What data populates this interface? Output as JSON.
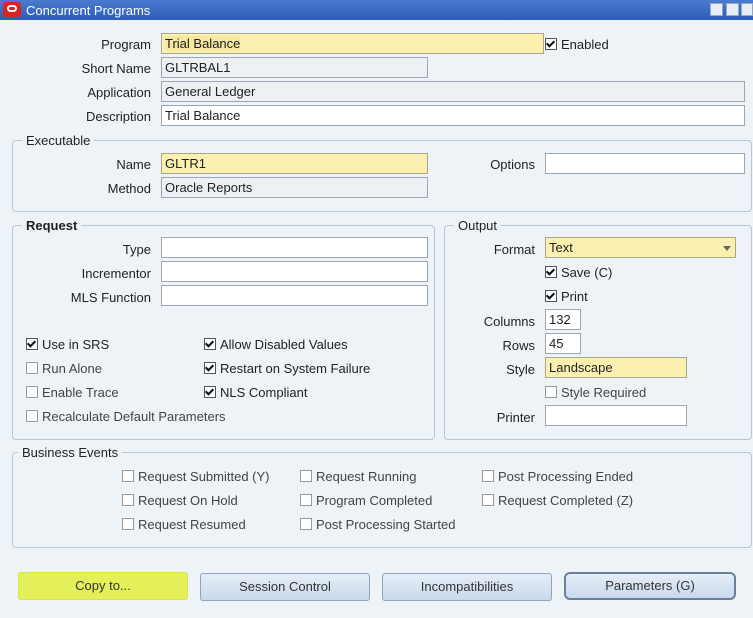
{
  "window": {
    "title": "Concurrent Programs"
  },
  "program": {
    "program_label": "Program",
    "program_value": "Trial Balance",
    "enabled_label": "Enabled",
    "enabled": true,
    "short_name_label": "Short Name",
    "short_name_value": "GLTRBAL1",
    "application_label": "Application",
    "application_value": "General Ledger",
    "description_label": "Description",
    "description_value": "Trial Balance"
  },
  "executable": {
    "title": "Executable",
    "name_label": "Name",
    "name_value": "GLTR1",
    "method_label": "Method",
    "method_value": "Oracle Reports",
    "options_label": "Options",
    "options_value": ""
  },
  "request": {
    "title": "Request",
    "type_label": "Type",
    "type_value": "",
    "incrementor_label": "Incrementor",
    "incrementor_value": "",
    "mls_label": "MLS Function",
    "mls_value": "",
    "checks": {
      "use_in_srs": "Use in SRS",
      "run_alone": "Run Alone",
      "enable_trace": "Enable Trace",
      "recalc": "Recalculate Default Parameters",
      "allow_disabled": "Allow Disabled Values",
      "restart": "Restart on System Failure",
      "nls": "NLS Compliant"
    }
  },
  "output": {
    "title": "Output",
    "format_label": "Format",
    "format_value": "Text",
    "save_label": "Save (C)",
    "print_label": "Print",
    "columns_label": "Columns",
    "columns_value": "132",
    "rows_label": "Rows",
    "rows_value": "45",
    "style_label": "Style",
    "style_value": "Landscape",
    "style_required_label": "Style Required",
    "printer_label": "Printer",
    "printer_value": ""
  },
  "business_events": {
    "title": "Business Events",
    "submitted": "Request Submitted (Y)",
    "on_hold": "Request On Hold",
    "resumed": "Request Resumed",
    "running": "Request Running",
    "completed_prog": "Program Completed",
    "pp_started": "Post Processing Started",
    "pp_ended": "Post Processing Ended",
    "req_completed": "Request Completed (Z)"
  },
  "buttons": {
    "copy": "Copy to...",
    "session": "Session Control",
    "incompat": "Incompatibilities",
    "params": "Parameters (G)"
  },
  "colors": {
    "highlight": "#e4f05a",
    "required_field": "#fcf0b0",
    "titlebar": "#2c5cb8"
  }
}
